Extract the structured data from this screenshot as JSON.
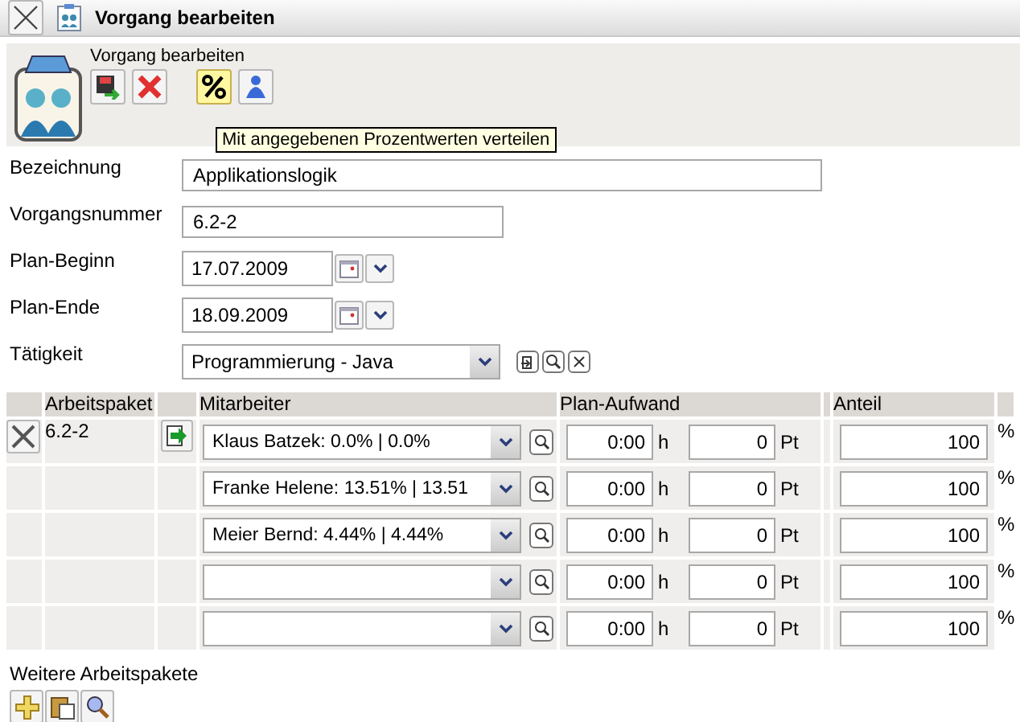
{
  "window": {
    "title": "Vorgang bearbeiten"
  },
  "toolbar": {
    "caption": "Vorgang bearbeiten",
    "tooltip": "Mit angegebenen Prozentwerten verteilen"
  },
  "form": [
    {
      "label": "Bezeichnung",
      "value": "Applikationslogik",
      "kind": "text"
    },
    {
      "label": "Vorgangsnummer",
      "value": "6.2-2",
      "kind": "text"
    },
    {
      "label": "Plan-Beginn",
      "value": "17.07.2009",
      "kind": "date"
    },
    {
      "label": "Plan-Ende",
      "value": "18.09.2009",
      "kind": "date"
    },
    {
      "label": "Tätigkeit",
      "value": "Programmierung - Java",
      "kind": "select"
    }
  ],
  "table": {
    "columns": [
      "Arbeitspaket",
      "Mitarbeiter",
      "Plan-Aufwand",
      "Anteil"
    ],
    "rows": [
      {
        "kind": "package",
        "package": "6.2-2",
        "employee": "Klaus Batzek: 0.0% | 0.0%",
        "hours": "0:00",
        "hours_unit": "h",
        "days": "0",
        "days_unit": "Pt",
        "share": "100",
        "share_unit": "%"
      },
      {
        "kind": "extra",
        "employee": "Franke Helene: 13.51% | 13.51",
        "hours": "0:00",
        "hours_unit": "h",
        "days": "0",
        "days_unit": "Pt",
        "share": "100",
        "share_unit": "%"
      },
      {
        "kind": "extra",
        "employee": "Meier Bernd: 4.44% | 4.44%",
        "hours": "0:00",
        "hours_unit": "h",
        "days": "0",
        "days_unit": "Pt",
        "share": "100",
        "share_unit": "%"
      },
      {
        "kind": "extra",
        "employee": "",
        "hours": "0:00",
        "hours_unit": "h",
        "days": "0",
        "days_unit": "Pt",
        "share": "100",
        "share_unit": "%"
      },
      {
        "kind": "extra",
        "employee": "",
        "hours": "0:00",
        "hours_unit": "h",
        "days": "0",
        "days_unit": "Pt",
        "share": "100",
        "share_unit": "%"
      }
    ]
  },
  "more": {
    "label": "Weitere Arbeitspakete"
  }
}
